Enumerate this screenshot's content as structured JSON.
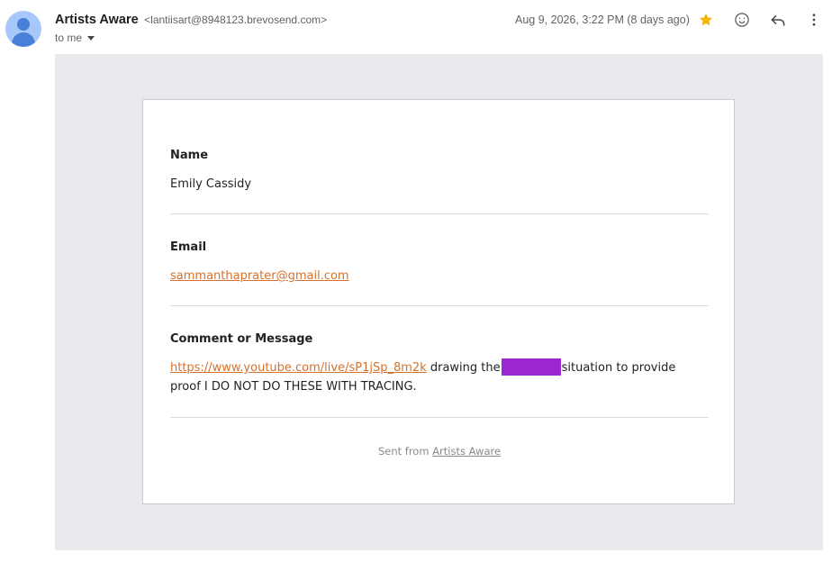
{
  "header": {
    "sender_name": "Artists Aware",
    "sender_email": "<lantiisart@8948123.brevosend.com>",
    "recipient_label": "to me",
    "date": "Aug 9, 2026, 3:22 PM (8 days ago)"
  },
  "icons": {
    "star": "star-icon",
    "emoji": "emoji-reaction-icon",
    "reply": "reply-icon",
    "more": "more-vert-icon",
    "star_color": "#f4b400"
  },
  "email_body": {
    "name": {
      "label": "Name",
      "value": "Emily Cassidy"
    },
    "email": {
      "label": "Email",
      "value": "sammanthaprater@gmail.com"
    },
    "message": {
      "label": "Comment or Message",
      "link": "https://www.youtube.com/live/sP1jSp_8m2k",
      "text_before_redaction": " drawing the",
      "text_after_redaction": "situation to provide proof I DO NOT DO THESE WITH TRACING."
    },
    "footer": {
      "prefix": "Sent from ",
      "link": "Artists Aware"
    }
  },
  "colors": {
    "accent_link": "#d4722d",
    "redaction": "#9b27d1",
    "background_panel": "#e8eaed"
  }
}
